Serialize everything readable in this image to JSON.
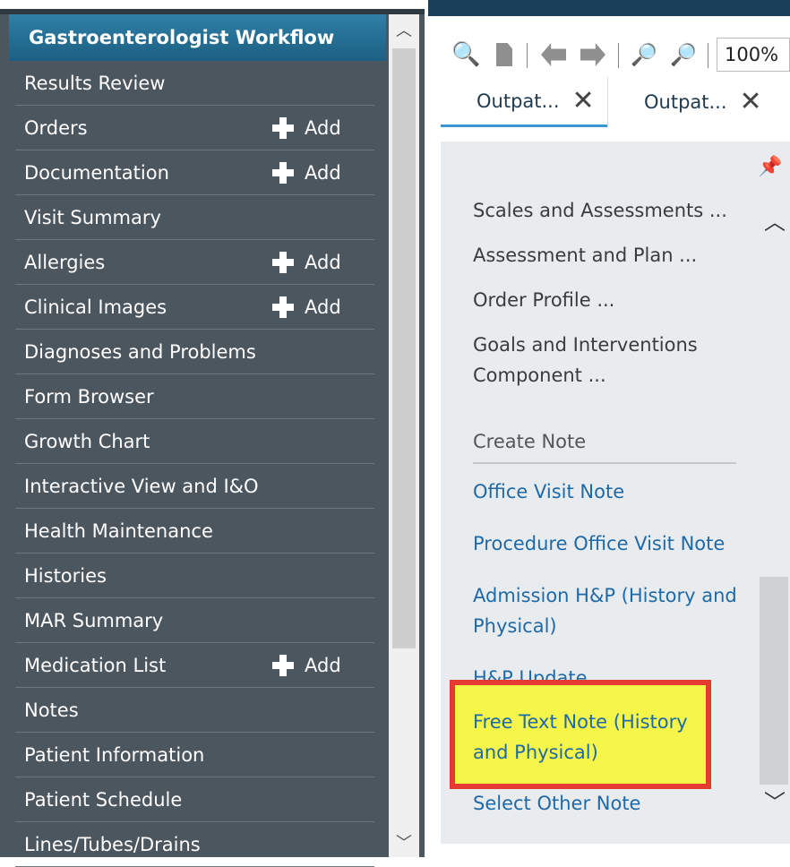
{
  "nav": {
    "header": "Gastroenterologist Workflow",
    "add_label": "Add",
    "items": [
      {
        "label": "Results Review",
        "add": false
      },
      {
        "label": "Orders",
        "add": true
      },
      {
        "label": "Documentation",
        "add": true
      },
      {
        "label": "Visit Summary",
        "add": false
      },
      {
        "label": "Allergies",
        "add": true
      },
      {
        "label": "Clinical Images",
        "add": true
      },
      {
        "label": "Diagnoses and Problems",
        "add": false
      },
      {
        "label": "Form Browser",
        "add": false
      },
      {
        "label": "Growth Chart",
        "add": false
      },
      {
        "label": "Interactive View and I&O",
        "add": false
      },
      {
        "label": "Health Maintenance",
        "add": false
      },
      {
        "label": "Histories",
        "add": false
      },
      {
        "label": "MAR Summary",
        "add": false
      },
      {
        "label": "Medication List",
        "add": true
      },
      {
        "label": "Notes",
        "add": false
      },
      {
        "label": "Patient Information",
        "add": false
      },
      {
        "label": "Patient Schedule",
        "add": false
      },
      {
        "label": "Lines/Tubes/Drains",
        "add": false
      }
    ]
  },
  "toolbar": {
    "zoom": "100%"
  },
  "tabs": [
    {
      "label": "Outpat...",
      "close": "✕"
    },
    {
      "label": "Outpat...",
      "close": "✕"
    }
  ],
  "content": {
    "sections": [
      "Scales and Assessments ...",
      "Assessment and Plan ...",
      "Order Profile ...",
      "Goals and Interventions Component ..."
    ],
    "create_note_heading": "Create Note",
    "note_links": [
      "Office Visit Note",
      "Procedure Office Visit Note",
      "Admission H&P (History and Physical)",
      "H&P Update"
    ],
    "highlighted_link": "Free Text Note (History and Physical)",
    "last_link": "Select Other Note"
  },
  "colors": {
    "nav_bg": "#4b565f",
    "header_bg": "#2a7097",
    "link": "#1e6aa8",
    "highlight_fill": "#f5f54a",
    "highlight_border": "#e53a32"
  }
}
